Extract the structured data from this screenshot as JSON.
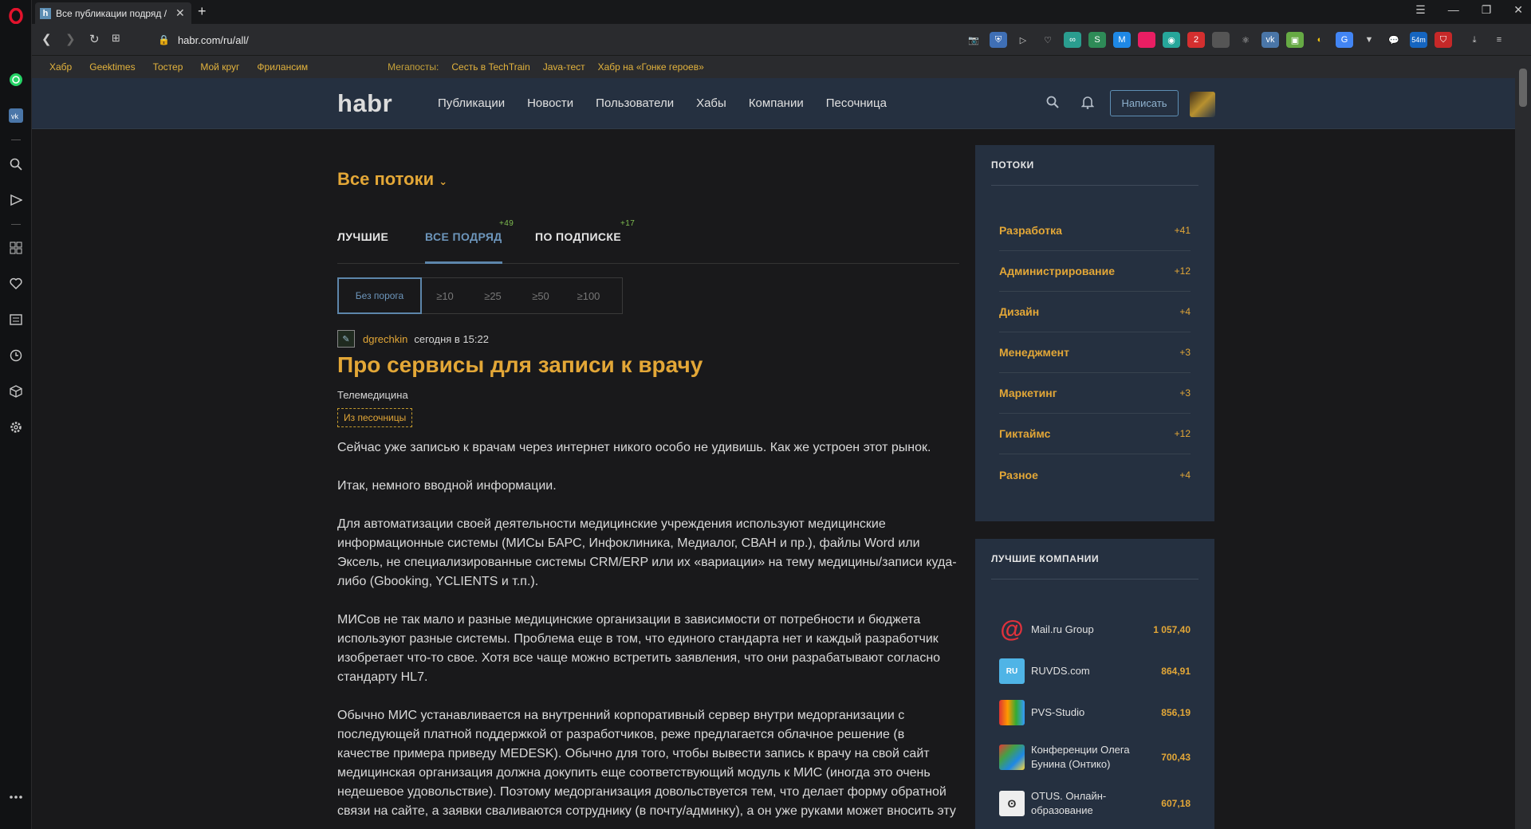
{
  "browser": {
    "tab_title": "Все публикации подряд /",
    "tab_favicon": "h",
    "url": "habr.com/ru/all/"
  },
  "bookmarks": {
    "items": [
      "Хабр",
      "Geektimes",
      "Тостер",
      "Мой круг",
      "Фрилансим"
    ],
    "megaposts_label": "Мегапосты:",
    "megaposts": [
      "Сесть в TechTrain",
      "Java-тест",
      "Хабр на «Гонке героев»"
    ]
  },
  "header": {
    "logo": "habr",
    "nav": [
      "Публикации",
      "Новости",
      "Пользователи",
      "Хабы",
      "Компании",
      "Песочница"
    ],
    "write_button": "Написать"
  },
  "feed": {
    "streams_title": "Все потоки",
    "tabs": [
      {
        "label": "ЛУЧШИЕ",
        "count": ""
      },
      {
        "label": "ВСЕ ПОДРЯД",
        "count": "+49"
      },
      {
        "label": "ПО ПОДПИСКЕ",
        "count": "+17"
      }
    ],
    "thresholds": [
      "Без порога",
      "≥10",
      "≥25",
      "≥50",
      "≥100"
    ]
  },
  "post": {
    "author": "dgrechkin",
    "time": "сегодня в 15:22",
    "title": "Про сервисы для записи к врачу",
    "hub": "Телемедицина",
    "badge": "Из песочницы",
    "paragraphs": [
      "Сейчас уже записью к врачам через интернет никого особо не удивишь. Как же устроен этот рынок.",
      "Итак, немного вводной информации.",
      "Для автоматизации своей деятельности медицинские учреждения используют медицинские информационные системы (МИСы БАРС, Инфоклиника, Медиалог, СВАН и пр.), файлы Word или Эксель, не специализированные системы CRM/ERP или их «вариации» на тему медицины/записи куда-либо (Gbooking, YCLIENTS и т.п.).",
      "МИСов не так мало и разные медицинские организации в зависимости от потребности и бюджета используют разные системы. Проблема еще в том, что единого стандарта нет и каждый разработчик изобретает что-то свое. Хотя все чаще можно встретить заявления, что они разрабатывают согласно стандарту HL7.",
      "Обычно МИС устанавливается на внутренний корпоративный сервер внутри медорганизации с последующей платной поддержкой от разработчиков, реже предлагается облачное решение (в качестве примера приведу MEDESK). Обычно для того, чтобы вывести запись к врачу на свой сайт медицинская организация должна докупить еще соответствующий модуль к МИС (иногда это очень недешевое удовольствие). Поэтому медорганизация довольствуется тем, что делает форму обратной связи на сайте, а заявки сваливаются сотруднику (в почту/админку), а он уже руками может вносить эту"
    ]
  },
  "sidebar": {
    "streams": {
      "title": "ПОТОКИ",
      "items": [
        {
          "name": "Разработка",
          "count": "+41"
        },
        {
          "name": "Администрирование",
          "count": "+12"
        },
        {
          "name": "Дизайн",
          "count": "+4"
        },
        {
          "name": "Менеджмент",
          "count": "+3"
        },
        {
          "name": "Маркетинг",
          "count": "+3"
        },
        {
          "name": "Гиктаймс",
          "count": "+12"
        },
        {
          "name": "Разное",
          "count": "+4"
        }
      ]
    },
    "companies": {
      "title": "ЛУЧШИЕ КОМПАНИИ",
      "items": [
        {
          "name": "Mail.ru Group",
          "rating": "1 057,40"
        },
        {
          "name": "RUVDS.com",
          "rating": "864,91"
        },
        {
          "name": "PVS-Studio",
          "rating": "856,19"
        },
        {
          "name": "Конференции Олега Бунина (Онтико)",
          "rating": "700,43"
        },
        {
          "name": "OTUS. Онлайн-образование",
          "rating": "607,18"
        }
      ]
    }
  }
}
